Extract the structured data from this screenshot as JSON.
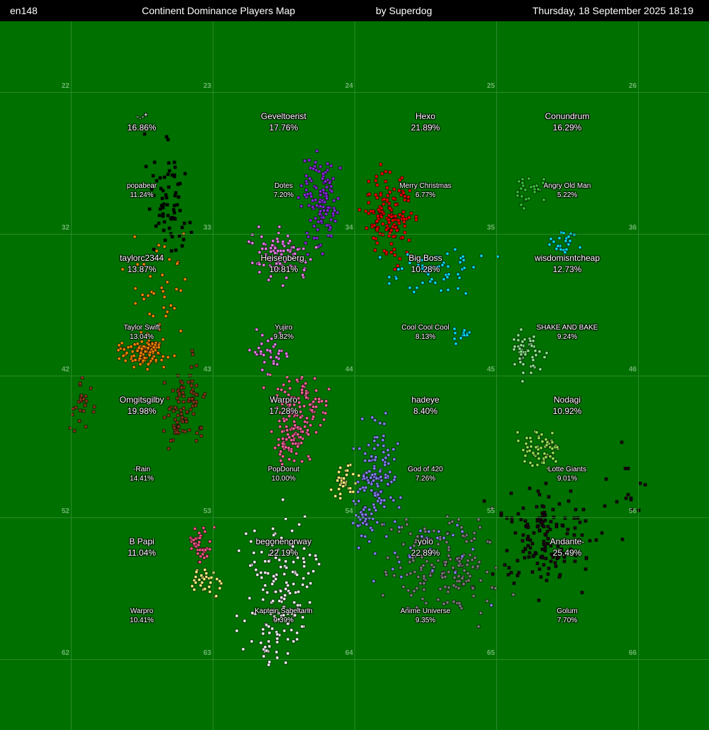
{
  "header": {
    "world": "en148",
    "title": "Continent Dominance Players Map",
    "author": "by Superdog",
    "datetime": "Thursday, 18 September 2025 18:19"
  },
  "continent_ids": [
    "22",
    "23",
    "24",
    "25",
    "26",
    "32",
    "33",
    "34",
    "35",
    "36",
    "42",
    "43",
    "44",
    "45",
    "46",
    "52",
    "53",
    "54",
    "55",
    "56",
    "62",
    "63",
    "64",
    "65",
    "66"
  ],
  "leaders": [
    {
      "name": "-.-*",
      "pct": "16.86%"
    },
    {
      "name": "Geveltoerist",
      "pct": "17.76%"
    },
    {
      "name": "Hexo",
      "pct": "21.89%"
    },
    {
      "name": "Conundrum",
      "pct": "16.29%"
    },
    {
      "name": "taylorc2344",
      "pct": "13.87%"
    },
    {
      "name": "Heisenberg.",
      "pct": "10.81%"
    },
    {
      "name": "Big Boss",
      "pct": "10.28%"
    },
    {
      "name": "wisdomisntcheap",
      "pct": "12.73%"
    },
    {
      "name": "Omgitsgilby",
      "pct": "19.98%"
    },
    {
      "name": "Warpro",
      "pct": "17.28%"
    },
    {
      "name": "hadeye",
      "pct": "8.40%"
    },
    {
      "name": "Nodagi",
      "pct": "10.92%"
    },
    {
      "name": "B Papi",
      "pct": "11.04%"
    },
    {
      "name": "begonenorway",
      "pct": "22.19%"
    },
    {
      "name": "yolo",
      "pct": "22.89%"
    },
    {
      "name": "Andante-",
      "pct": "25.49%"
    }
  ],
  "seconds": [
    {
      "name": "popabear",
      "pct": "11.24%"
    },
    {
      "name": "Dotes",
      "pct": "7.20%"
    },
    {
      "name": "Merry Christmas",
      "pct": "6.77%"
    },
    {
      "name": "Angry Old Man",
      "pct": "5.22%"
    },
    {
      "name": "Taylor Swift",
      "pct": "13.04%"
    },
    {
      "name": "Yujiro",
      "pct": "9.82%"
    },
    {
      "name": "Cool Cool Cool",
      "pct": "8.13%"
    },
    {
      "name": "SHAKE AND BAKE",
      "pct": "9.24%"
    },
    {
      "name": "-Rain",
      "pct": "14.41%"
    },
    {
      "name": "PopDonut",
      "pct": "10.00%"
    },
    {
      "name": "God of 420",
      "pct": "7.26%"
    },
    {
      "name": "Lotte Giants",
      "pct": "9.01%"
    },
    {
      "name": "Warpro",
      "pct": "10.41%"
    },
    {
      "name": "Kaptein Sabeltann",
      "pct": "9.39%"
    },
    {
      "name": "Anime Universe",
      "pct": "9.35%"
    },
    {
      "name": "Golum",
      "pct": "7.70%"
    }
  ],
  "colors": {
    "background": "#007000",
    "grid": "#2a8a2a",
    "header_bg": "#000000"
  },
  "village_clusters": [
    {
      "player": "-.-*",
      "color": "#000000"
    },
    {
      "player": "Geveltoerist",
      "color": "#8a2be2"
    },
    {
      "player": "Hexo",
      "color": "#ff0000"
    },
    {
      "player": "Conundrum",
      "color": "#33cc33"
    },
    {
      "player": "Heisenberg.",
      "color": "#ee82ee"
    },
    {
      "player": "Big Boss",
      "color": "#00e5ff"
    },
    {
      "player": "wisdomisntcheap",
      "color": "#00e5ff"
    },
    {
      "player": "taylorc2344",
      "color": "#ff8c00"
    },
    {
      "player": "SHAKE AND BAKE",
      "color": "#90ee90"
    },
    {
      "player": "Omgitsgilby",
      "color": "#8b3a1a"
    },
    {
      "player": "Warpro",
      "color": "#ff6aa0"
    },
    {
      "player": "hadeye",
      "color": "#8888ff"
    },
    {
      "player": "Nodagi",
      "color": "#99ee55"
    },
    {
      "player": "Andante-",
      "color": "#1a0010"
    },
    {
      "player": "B Papi",
      "color": "#ff5a8c"
    },
    {
      "player": "begonenorway",
      "color": "#ffffff"
    },
    {
      "player": "yolo",
      "color": "#808080"
    },
    {
      "player": "PopDonut",
      "color": "#ffff80"
    }
  ]
}
